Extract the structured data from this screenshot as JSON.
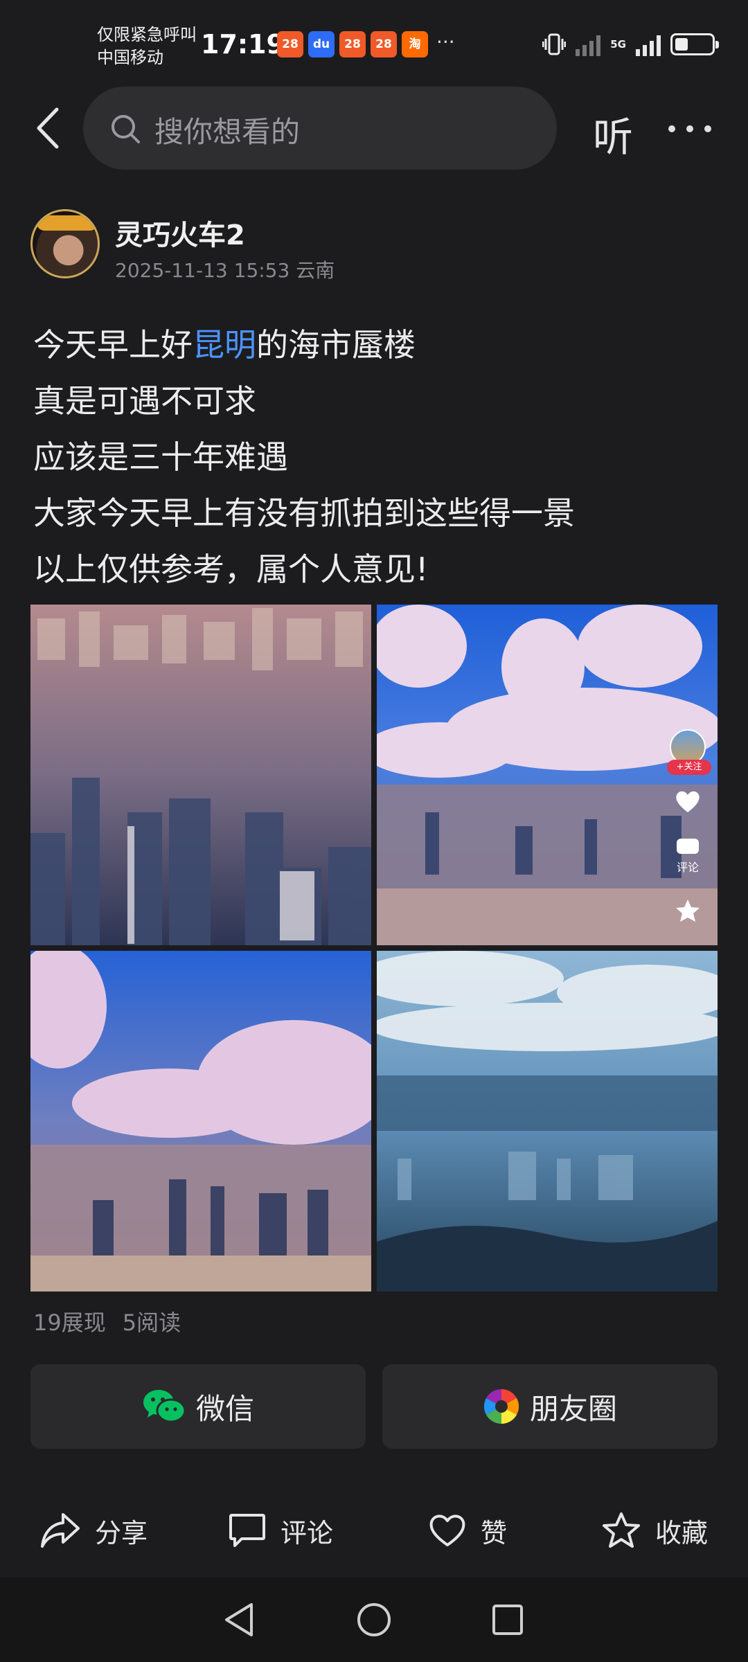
{
  "status_bar": {
    "carrier_line1": "仅限紧急呼叫",
    "carrier_line2": "中国移动",
    "time": "17:19",
    "notifications": [
      {
        "name": "app-notif-1",
        "label": "28",
        "color": "#f05a28"
      },
      {
        "name": "baidu-notif",
        "label": "du",
        "color": "#2f6cf6"
      },
      {
        "name": "app-notif-2",
        "label": "28",
        "color": "#f05a28"
      },
      {
        "name": "app-notif-3",
        "label": "28",
        "color": "#f05a28"
      },
      {
        "name": "taobao-notif",
        "label": "淘",
        "color": "#ff6a00"
      }
    ],
    "more": "···",
    "network": "5G",
    "battery_level": 0.35
  },
  "header": {
    "search_placeholder": "搜你想看的",
    "listen_label": "听"
  },
  "post": {
    "author": "灵巧火车2",
    "meta": "2025-11-13 15:53 云南",
    "lines": [
      {
        "pre": "今天早上好",
        "highlight": "昆明",
        "post": "的海市蜃楼"
      },
      {
        "text": "真是可遇不可求"
      },
      {
        "text": "应该是三十年难遇"
      },
      {
        "text": "大家今天早上有没有抓拍到这些得一景"
      },
      {
        "text": "以上仅供参考，属个人意见!"
      }
    ],
    "image_overlay": {
      "follow_label": "+关注",
      "comment_label": "评论"
    },
    "stats": {
      "impressions": "19展现",
      "reads": "5阅读"
    }
  },
  "share": {
    "wechat_label": "微信",
    "moments_label": "朋友圈"
  },
  "actions": {
    "share_label": "分享",
    "comment_label": "评论",
    "like_label": "赞",
    "favorite_label": "收藏"
  },
  "colors": {
    "background": "#1c1c1e",
    "link": "#4d93ff",
    "wechat_green": "#07c160"
  }
}
